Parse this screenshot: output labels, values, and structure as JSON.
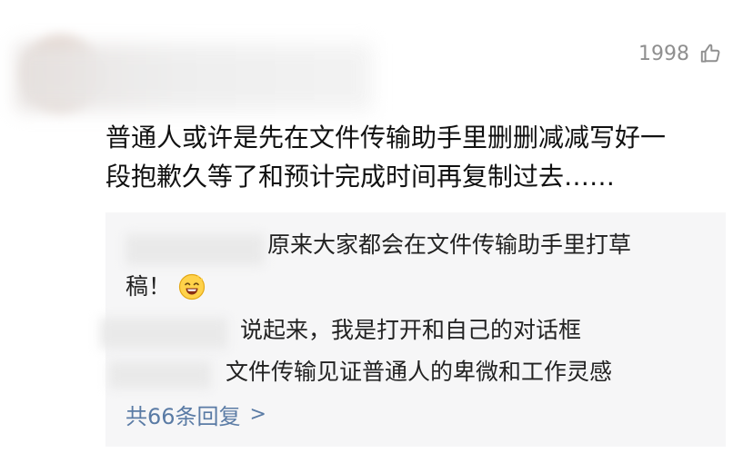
{
  "like": {
    "count": "1998"
  },
  "comment": {
    "line1": "普通人或许是先在文件传输助手里删删减减写好一",
    "line2": "段抱歉久等了和预计完成时间再复制过去……"
  },
  "replies": [
    {
      "text_line1": "原来大家都会在文件传输助手里打草",
      "text_line2": "稿！"
    },
    {
      "text": "说起来，我是打开和自己的对话框"
    },
    {
      "text": "文件传输见证普通人的卑微和工作灵感"
    }
  ],
  "more_replies": {
    "label": "共66条回复",
    "chevron": ">"
  },
  "icons": {
    "like": "thumb-up-outline-icon",
    "emoji": "grin-emoji-icon"
  },
  "colors": {
    "link": "#5a7ba5",
    "meta": "#8f8f8f",
    "panel_bg": "#f6f6f7"
  }
}
